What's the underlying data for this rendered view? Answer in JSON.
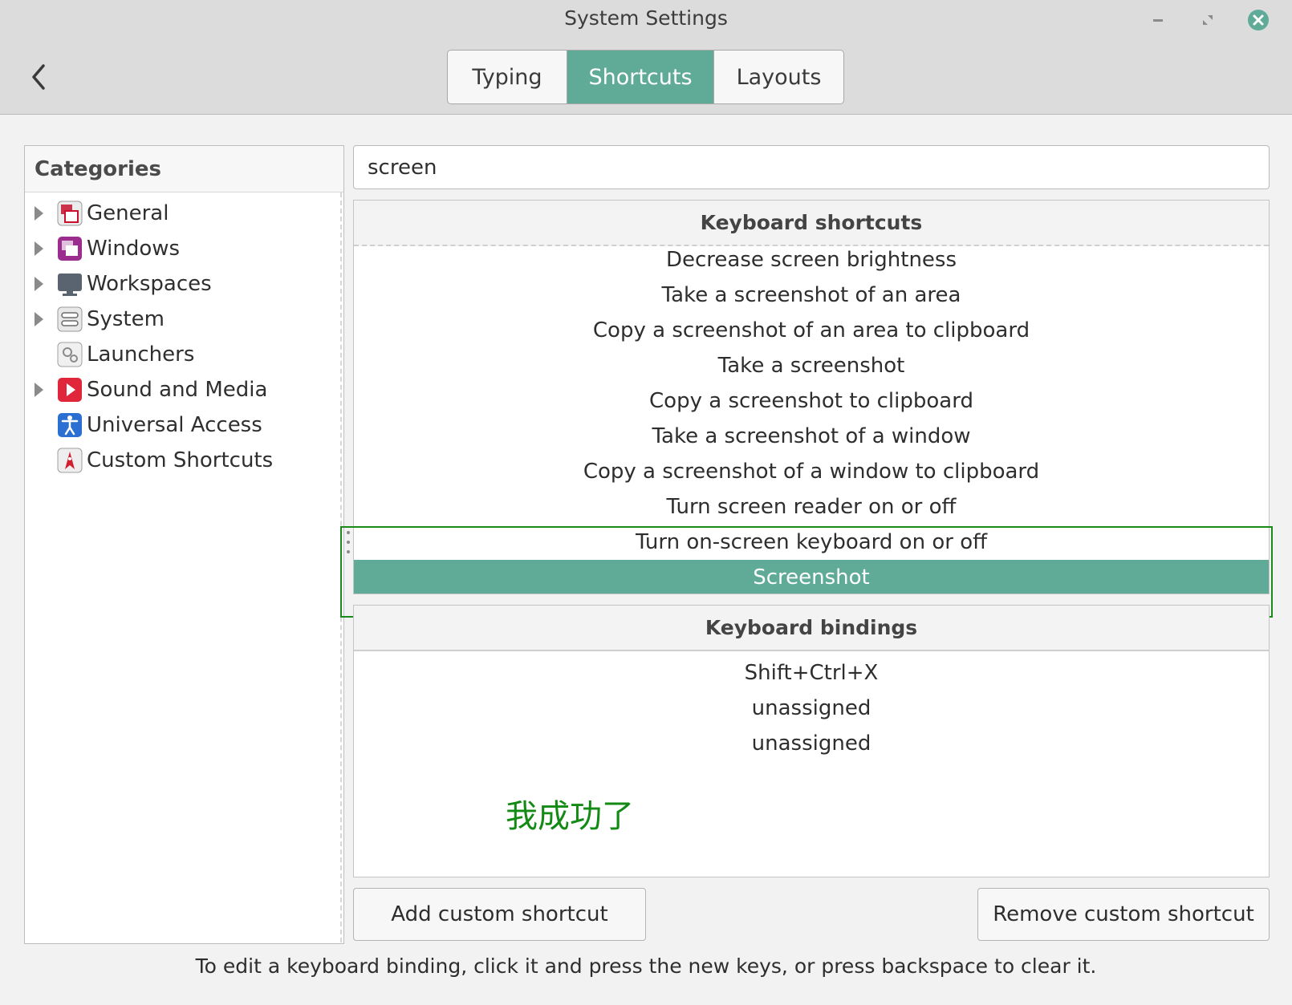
{
  "window": {
    "title": "System Settings"
  },
  "tabs": [
    {
      "label": "Typing",
      "active": false
    },
    {
      "label": "Shortcuts",
      "active": true
    },
    {
      "label": "Layouts",
      "active": false
    }
  ],
  "categories": {
    "header": "Categories",
    "items": [
      {
        "label": "General",
        "icon": "general-icon",
        "expandable": true
      },
      {
        "label": "Windows",
        "icon": "windows-icon",
        "expandable": true
      },
      {
        "label": "Workspaces",
        "icon": "workspaces-icon",
        "expandable": true
      },
      {
        "label": "System",
        "icon": "system-icon",
        "expandable": true
      },
      {
        "label": "Launchers",
        "icon": "launchers-icon",
        "expandable": false
      },
      {
        "label": "Sound and Media",
        "icon": "sound-media-icon",
        "expandable": true
      },
      {
        "label": "Universal Access",
        "icon": "universal-access-icon",
        "expandable": false
      },
      {
        "label": "Custom Shortcuts",
        "icon": "custom-shortcuts-icon",
        "expandable": false
      }
    ]
  },
  "search": {
    "value": "screen"
  },
  "shortcuts": {
    "header": "Keyboard shortcuts",
    "items": [
      "Decrease screen brightness",
      "Take a screenshot of an area",
      "Copy a screenshot of an area to clipboard",
      "Take a screenshot",
      "Copy a screenshot to clipboard",
      "Take a screenshot of a window",
      "Copy a screenshot of a window to clipboard",
      "Turn screen reader on or off",
      "Turn on-screen keyboard on or off",
      "Screenshot"
    ],
    "selected": "Screenshot"
  },
  "bindings": {
    "header": "Keyboard bindings",
    "items": [
      "Shift+Ctrl+X",
      "unassigned",
      "unassigned"
    ]
  },
  "overlay_text": "我成功了",
  "buttons": {
    "add": "Add custom shortcut",
    "remove": "Remove custom shortcut"
  },
  "hint": "To edit a keyboard binding, click it and press the new keys, or press backspace to clear it.",
  "colors": {
    "accent": "#5fab97",
    "close": "#5fab97",
    "annotation": "#138a13"
  }
}
